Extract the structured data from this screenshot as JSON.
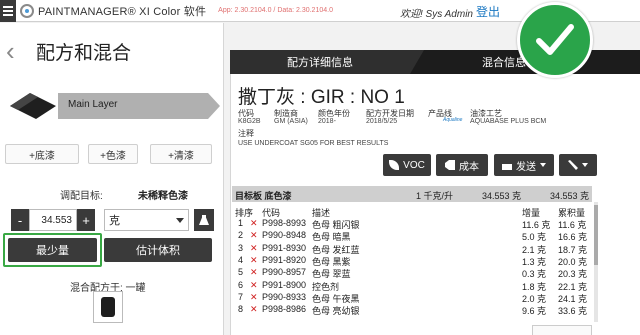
{
  "topbar": {
    "title": "PAINTMANAGER® XI Color 软件",
    "version": "App: 2.30.2104.0 / Data: 2.30.2104.0",
    "welcome": "欢迎!  Sys Admin",
    "logout": "登出"
  },
  "left": {
    "title": "配方和混合",
    "layer_label": "Main Layer",
    "buttons": {
      "base": "+底漆",
      "color": "+色漆",
      "clear": "+清漆"
    },
    "target_label": "调配目标:",
    "target_value": "未稀释色漆",
    "quantity": "34.553",
    "unit": "克",
    "minus": "-",
    "plus": "+",
    "min_button": "最少量",
    "estimate_button": "估计体积",
    "mix_label": "混合配方于:   一罐"
  },
  "right": {
    "tabs": {
      "detail": "配方详细信息",
      "mix": "混合信息"
    },
    "formula_name": "撒丁灰 : GIR : NO 1",
    "meta": {
      "labels": [
        "代码",
        "制造商",
        "颜色年份",
        "配方开发日期",
        "产品线",
        "油漆工艺"
      ],
      "values": [
        "K8G2B",
        "GM (ASIA)",
        "2018-",
        "2018/5/25",
        "Aqualine",
        "AQUABASE PLUS BCM"
      ]
    },
    "note_label": "注释",
    "note_value": "USE UNDERCOAT SG05 FOR BEST RESULTS",
    "toolbar": {
      "voc": "VOC",
      "cost": "成本",
      "send": "发送"
    },
    "table_head": {
      "target": "目标板 底色漆",
      "ratio": "1 千克/升",
      "amount": "34.553 克",
      "cumulative": "34.553 克"
    },
    "columns": {
      "order": "排序",
      "code": "代码",
      "desc": "描述",
      "amount": "增量",
      "cumulative": "累积量"
    },
    "rows": [
      {
        "order": "1",
        "code": "P998-8993",
        "desc": "色母 粗闪银",
        "amount": "11.6 克",
        "cum": "11.6 克"
      },
      {
        "order": "2",
        "code": "P990-8948",
        "desc": "色母 暗黑",
        "amount": "5.0 克",
        "cum": "16.6 克"
      },
      {
        "order": "3",
        "code": "P991-8930",
        "desc": "色母 发红蓝",
        "amount": "2.1 克",
        "cum": "18.7 克"
      },
      {
        "order": "4",
        "code": "P991-8920",
        "desc": "色母 黑紫",
        "amount": "1.3 克",
        "cum": "20.0 克"
      },
      {
        "order": "5",
        "code": "P990-8957",
        "desc": "色母 翠蓝",
        "amount": "0.3 克",
        "cum": "20.3 克"
      },
      {
        "order": "6",
        "code": "P991-8900",
        "desc": "控色剂",
        "amount": "1.8 克",
        "cum": "22.1 克"
      },
      {
        "order": "7",
        "code": "P990-8933",
        "desc": "色母 午夜黑",
        "amount": "2.0 克",
        "cum": "24.1 克"
      },
      {
        "order": "8",
        "code": "P998-8986",
        "desc": "色母 亮幼银",
        "amount": "9.6 克",
        "cum": "33.6 克"
      }
    ]
  },
  "colors": {
    "accent_green": "#2aa44a",
    "link_blue": "#1b78c2",
    "dark_button": "#3a3a3a",
    "delete_red": "#d02020"
  }
}
